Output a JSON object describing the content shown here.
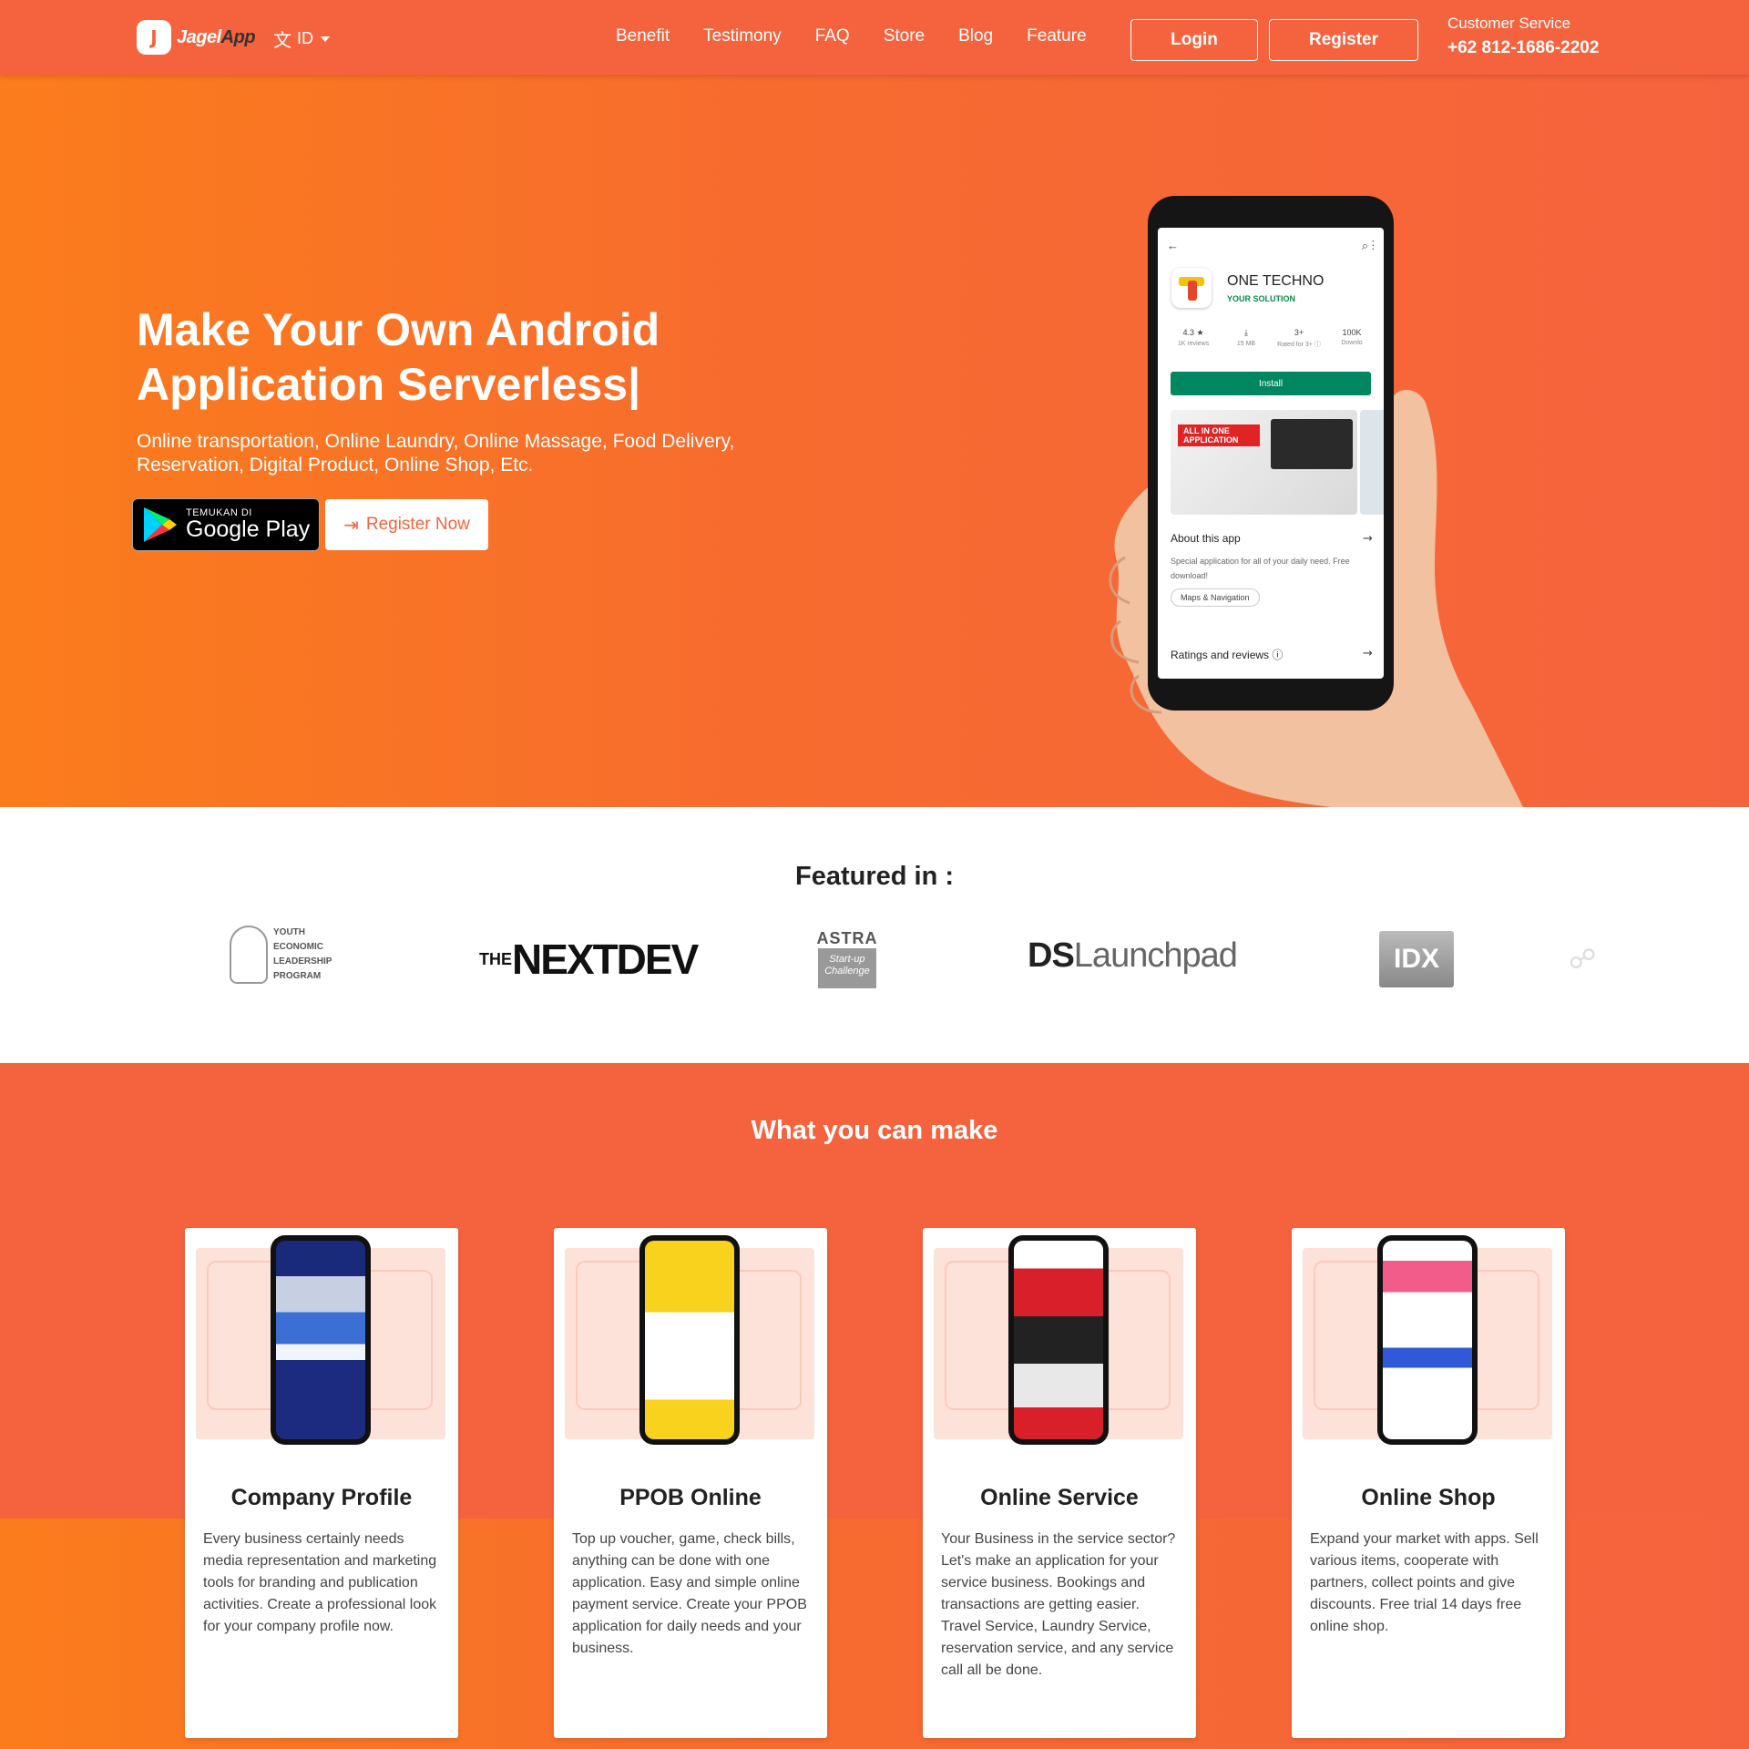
{
  "brand": {
    "logo_letter": "J",
    "name_part1": "Jagel",
    "name_part2": "App",
    "accent": "#f5633e"
  },
  "lang": {
    "icon": "translate-icon",
    "value": "ID"
  },
  "nav": {
    "links": [
      "Benefit",
      "Testimony",
      "FAQ",
      "Store",
      "Blog",
      "Feature"
    ],
    "login": "Login",
    "register": "Register"
  },
  "customer_service": {
    "label": "Customer Service",
    "phone": "+62 812-1686-2202"
  },
  "hero": {
    "title_line1": "Make Your Own Android",
    "title_line2": "Application Serverless|",
    "subtitle": "Online transportation, Online Laundry, Online Massage, Food Delivery, Reservation, Digital Product, Online Shop, Etc.",
    "google_play_small": "TEMUKAN DI",
    "google_play_big": "Google Play",
    "register_now": "Register Now"
  },
  "phone_mock": {
    "app_name": "ONE TECHNO",
    "app_tagline": "YOUR SOLUTION",
    "stats": [
      {
        "value": "4.3 ★",
        "label": "1K reviews"
      },
      {
        "value": "⤓",
        "label": "15 MB"
      },
      {
        "value": "3+",
        "label": "Rated for 3+ ⓘ"
      },
      {
        "value": "100K",
        "label": "Downlo"
      }
    ],
    "install": "Install",
    "banner_tag": "ALL IN ONE APPLICATION",
    "about_title": "About this app",
    "about_desc": "Special application for all of your daily need. Free download!",
    "chip": "Maps & Navigation",
    "ratings_title": "Ratings and reviews ⓘ"
  },
  "featured": {
    "title": "Featured in :",
    "logos": {
      "yelp": "YOUTH ECONOMIC LEADERSHIP PROGRAM",
      "nextdev_the": "THE",
      "nextdev": "NEXTDEV",
      "astra": "ASTRA",
      "astra_sub": "Start-up Challenge",
      "ds_a": "DS",
      "ds_b": "Launchpad",
      "idx": "IDX"
    }
  },
  "make": {
    "title": "What you can make",
    "cards": [
      {
        "title": "Company Profile",
        "desc": "Every business certainly needs media representation and marketing tools for branding and publication activities. Create a professional look for your company profile now."
      },
      {
        "title": "PPOB Online",
        "desc": "Top up voucher, game, check bills, anything can be done with one application. Easy and simple online payment service. Create your PPOB application for daily needs and your business."
      },
      {
        "title": "Online Service",
        "desc": "Your Business in the service sector? Let's make an application for your service business. Bookings and transactions are getting easier. Travel Service, Laundry Service, reservation service, and any service call all be done."
      },
      {
        "title": "Online Shop",
        "desc": "Expand your market with apps. Sell various items, cooperate with partners, collect points and give discounts. Free trial 14 days free online shop."
      }
    ]
  }
}
